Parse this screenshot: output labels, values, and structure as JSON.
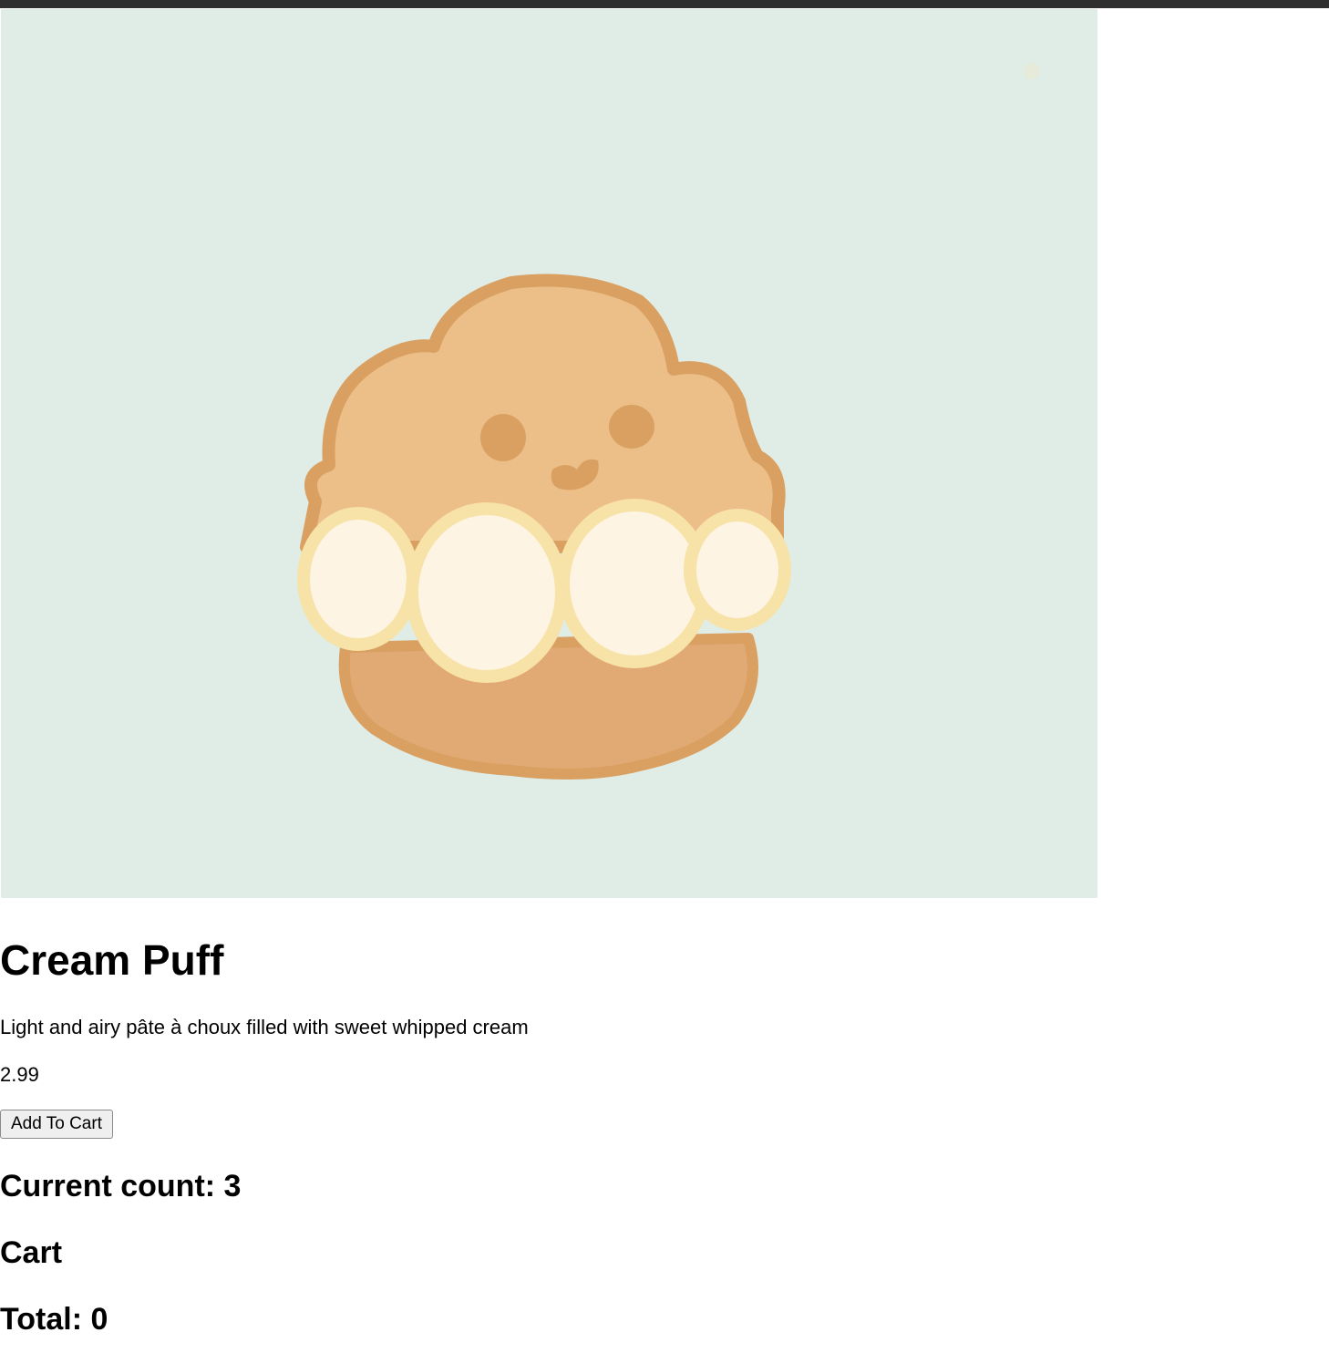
{
  "product": {
    "image_alt": "cream-puff-illustration",
    "title": "Cream Puff",
    "description": "Light and airy pâte à choux filled with sweet whipped cream",
    "price": "2.99",
    "add_button_label": "Add To Cart"
  },
  "counter": {
    "label": "Current count: 3"
  },
  "cart": {
    "heading": "Cart",
    "total": "Total: 0"
  },
  "colors": {
    "image_background": "#e0ede6",
    "pastry_outline": "#d9a062",
    "pastry_fill": "#ecbf88",
    "cream_outline": "#f7e2a8",
    "cream_fill": "#fdf4e3",
    "topbar": "#2f2f2f"
  }
}
